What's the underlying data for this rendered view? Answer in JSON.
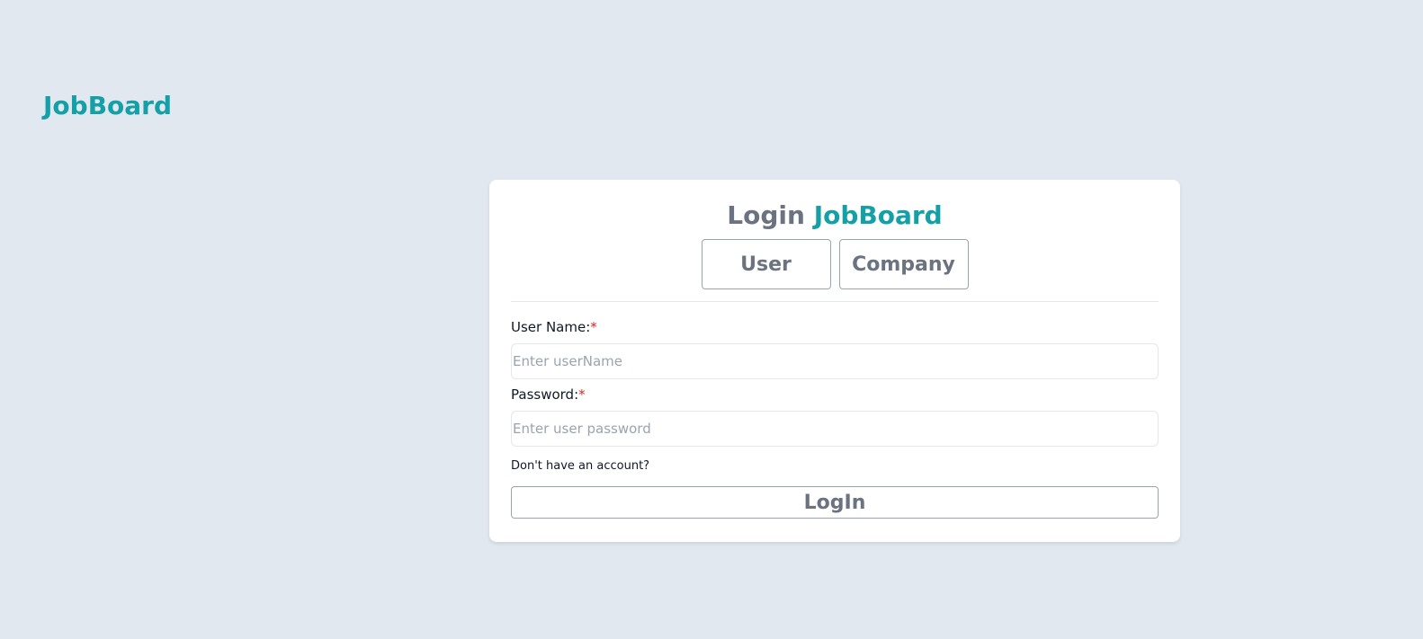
{
  "header": {
    "brand": "JobBoard"
  },
  "login_card": {
    "title_prefix": "Login",
    "title_brand": "JobBoard",
    "tabs": [
      {
        "label": "User"
      },
      {
        "label": "Company"
      }
    ],
    "username": {
      "label": "User Name:",
      "required_mark": "*",
      "placeholder": "Enter userName",
      "value": ""
    },
    "password": {
      "label": "Password:",
      "required_mark": "*",
      "placeholder": "Enter user password",
      "value": ""
    },
    "signup_text": "Don't have an account?",
    "submit_label": "LogIn"
  },
  "colors": {
    "accent": "#14a0a6",
    "background": "#e2e8f0",
    "muted_text": "#6b7280",
    "required": "#dc2626"
  }
}
